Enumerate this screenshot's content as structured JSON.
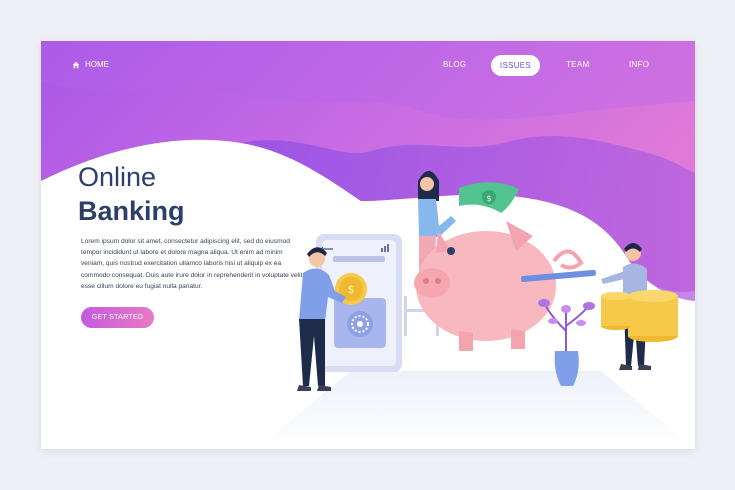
{
  "nav": {
    "home_label": "HOME",
    "items": [
      {
        "label": "BLOG"
      },
      {
        "label": "ISSUES",
        "active": true
      },
      {
        "label": "TEAM"
      },
      {
        "label": "INFO"
      }
    ]
  },
  "hero": {
    "title_line1": "Online",
    "title_line2": "Banking",
    "body": "Lorem ipsum dolor sit amet, consectetur adipiscing elit, sed do eiusmod tempor incididunt ut labore et dolore magna aliqua. Ut enim ad minim veniam, quis nostrud exercitation ullamco laboris nisi ut aliquip ex ea commodo consequat. Duis aute irure dolor in reprehenderit in voluptate velit esse cillum dolore eu fugiat nulla pariatur.",
    "cta_label": "GET STARTED"
  },
  "colors": {
    "accent": "#8d4ee8",
    "accent_pink": "#e26fd0",
    "title": "#2c3e6a",
    "piggy": "#f8b8c0"
  },
  "icons": [
    "home-icon",
    "dollar-icon",
    "safe-icon",
    "signal-icon"
  ]
}
